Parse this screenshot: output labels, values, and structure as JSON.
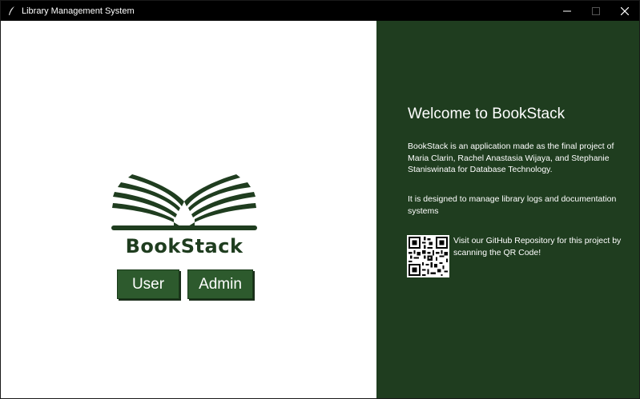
{
  "window": {
    "title": "Library Management System",
    "icon": "feather-icon"
  },
  "controls": {
    "minimize_icon": "minimize-icon",
    "maximize_icon": "maximize-icon",
    "close_icon": "close-icon"
  },
  "brand": {
    "name": "BookStack",
    "logo_icon": "open-book-icon",
    "color": "#1f3d1f"
  },
  "buttons": {
    "user_label": "User",
    "admin_label": "Admin",
    "color": "#2d5a2d"
  },
  "info": {
    "heading": "Welcome to BookStack",
    "paragraph1": "BookStack is an application made as the final project of Maria Clarin, Rachel Anastasia Wijaya, and Stephanie Staniswinata for Database Technology.",
    "paragraph2": "It is designed to manage library logs and documentation systems",
    "qr_text": "Visit our GitHub Repository for this project by scanning the QR Code!",
    "qr_icon": "qr-code-icon",
    "background": "#1f3d1f"
  }
}
